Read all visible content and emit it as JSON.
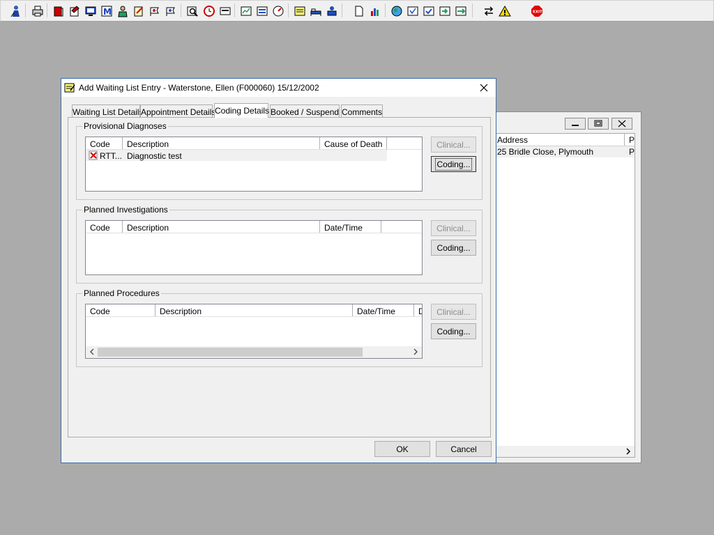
{
  "toolbar": {
    "icons": [
      "person-icon",
      "printer-icon",
      "book-icon",
      "notes-icon",
      "screen-icon",
      "m-icon",
      "doctor-icon",
      "edit-icon",
      "flag-icon",
      "flag2-icon",
      "search-icon",
      "clock-icon",
      "card-icon",
      "chart-icon",
      "list-icon",
      "dial-icon",
      "note-icon",
      "bed-icon",
      "patient-icon",
      "document-icon",
      "bar-chart-icon",
      "globe-icon",
      "form-icon",
      "check-form-icon",
      "arrow-form-icon",
      "green-form-icon",
      "transfer-icon",
      "warning-icon",
      "exit-icon"
    ],
    "exit_label": "EXIT"
  },
  "background_window": {
    "column_address": "Address",
    "column_p": "P",
    "row_address": "25 Bridle Close, Plymouth",
    "row_p": "P"
  },
  "dialog": {
    "title": "Add Waiting List Entry - Waterstone, Ellen (F000060) 15/12/2002",
    "tabs": [
      {
        "label": "Waiting List Details"
      },
      {
        "label": "Appointment Details"
      },
      {
        "label": "Coding Details"
      },
      {
        "label": "Booked / Suspend"
      },
      {
        "label": "Comments"
      }
    ],
    "provisional": {
      "label": "Provisional Diagnoses",
      "columns": [
        "Code",
        "Description",
        "Cause of Death"
      ],
      "row": {
        "code": "RTT...",
        "description": "Diagnostic test"
      },
      "clinical": "Clinical...",
      "coding": "Coding..."
    },
    "investigations": {
      "label": "Planned Investigations",
      "columns": [
        "Code",
        "Description",
        "Date/Time"
      ],
      "clinical": "Clinical...",
      "coding": "Coding..."
    },
    "procedures": {
      "label": "Planned Procedures",
      "columns": [
        "Code",
        "Description",
        "Date/Time",
        "D"
      ],
      "clinical": "Clinical...",
      "coding": "Coding..."
    },
    "ok": "OK",
    "cancel": "Cancel"
  },
  "colors": {
    "desktop": "#ababab",
    "dialog_border": "#3a6ea5",
    "window_face": "#f0f0f0"
  }
}
